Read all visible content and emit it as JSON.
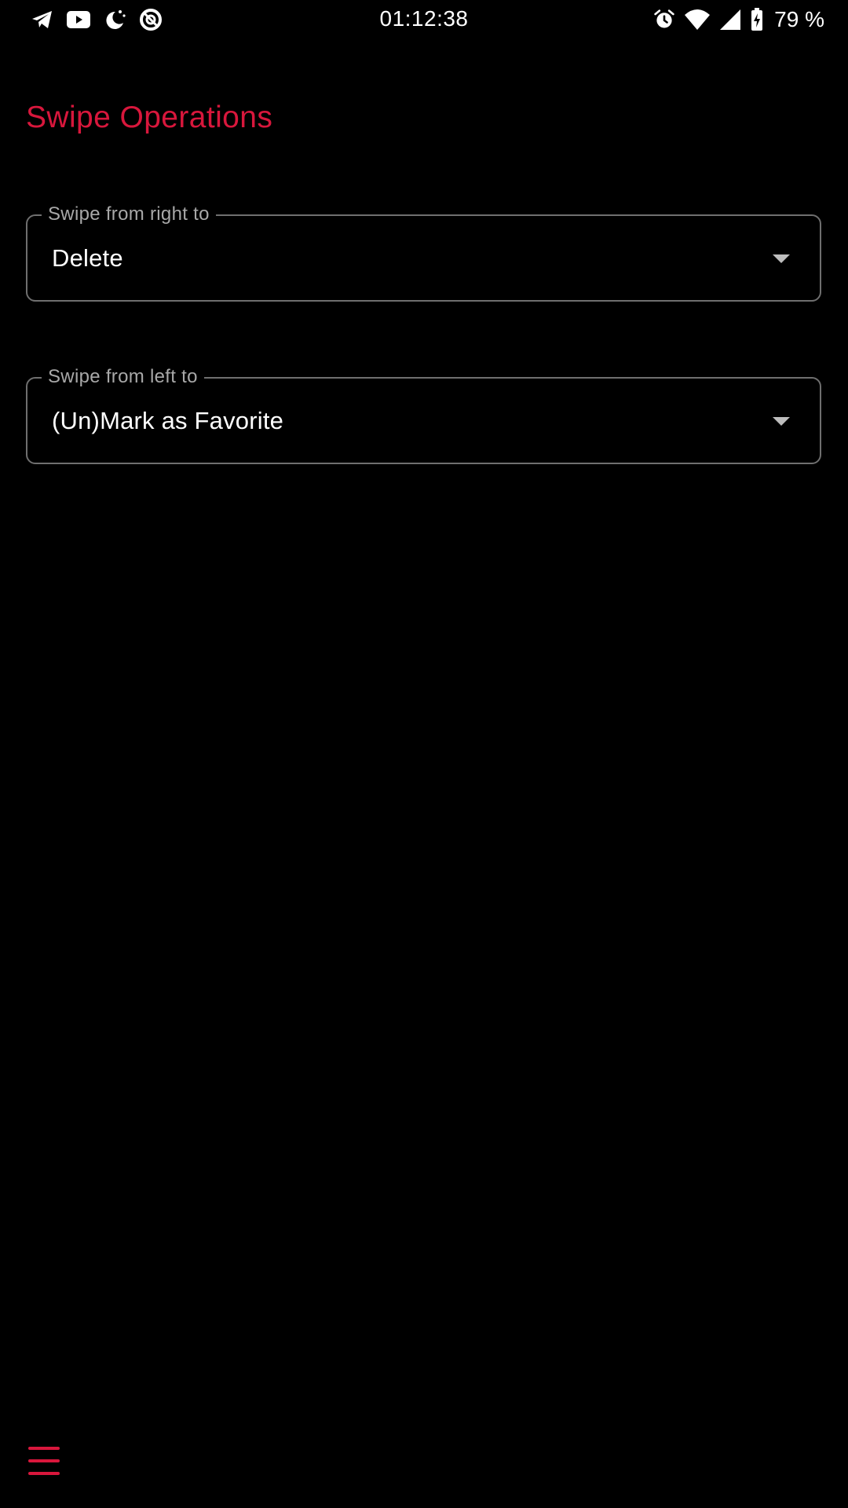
{
  "status_bar": {
    "time": "01:12:38",
    "battery": "79 %",
    "left_icons": [
      "telegram-icon",
      "youtube-icon",
      "do-not-disturb-icon",
      "data-saver-icon"
    ],
    "right_icons": [
      "alarm-icon",
      "wifi-icon",
      "signal-icon",
      "battery-charging-icon"
    ]
  },
  "colors": {
    "accent": "#D8173C",
    "background": "#000000",
    "outline": "#6F6F6F",
    "label": "#A8A8A8",
    "text": "#FFFFFF"
  },
  "page": {
    "title": "Swipe Operations"
  },
  "fields": {
    "swipe_right": {
      "label": "Swipe from right to",
      "value": "Delete"
    },
    "swipe_left": {
      "label": "Swipe from left to",
      "value": "(Un)Mark as Favorite"
    }
  },
  "bottom": {
    "menu_icon": "menu-icon"
  }
}
